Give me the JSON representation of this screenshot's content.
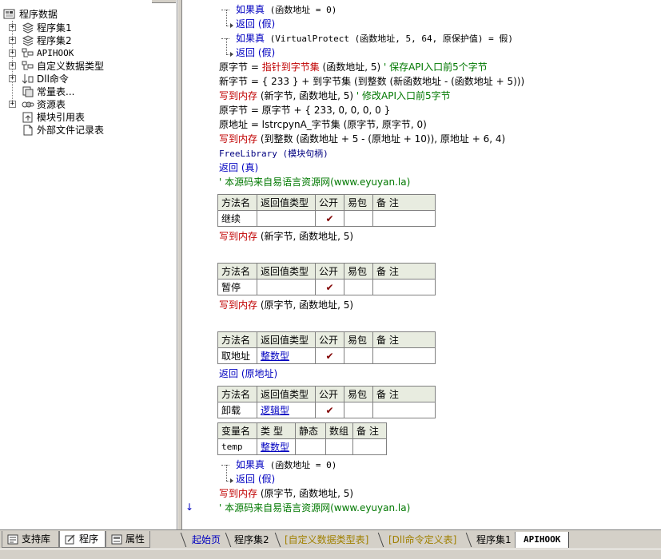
{
  "tree": {
    "root": "程序数据",
    "items": [
      {
        "label": "程序集1",
        "expandable": true
      },
      {
        "label": "程序集2",
        "expandable": true
      },
      {
        "label": "APIHOOK",
        "expandable": true
      },
      {
        "label": "自定义数据类型",
        "expandable": true
      },
      {
        "label": "Dll命令",
        "expandable": true
      },
      {
        "label": "常量表...",
        "expandable": false
      },
      {
        "label": "资源表",
        "expandable": true
      },
      {
        "label": "模块引用表",
        "expandable": false
      },
      {
        "label": "外部文件记录表",
        "expandable": false
      }
    ]
  },
  "code": {
    "lines": {
      "l1_kw": "如果真",
      "l1_rest": " (函数地址 = 0)",
      "l2": "返回 (假)",
      "l3_kw": "如果真",
      "l3_rest": " (VirtualProtect (函数地址, 5, 64, 原保护值) = 假)",
      "l4": "返回 (假)",
      "l5_a": "原字节 = ",
      "l5_b": "指针到字节集",
      "l5_c": " (函数地址, 5) ",
      "l5_cmt": "' 保存API入口前5个字节",
      "l6": "新字节 = { 233 } + 到字节集 (到整数 (新函数地址 - (函数地址 + 5)))",
      "l7_a": "写到内存",
      "l7_b": " (新字节, 函数地址, 5) ",
      "l7_cmt": "' 修改API入口前5字节",
      "l8": "原字节 = 原字节 + { 233, 0, 0, 0, 0 }",
      "l9": "原地址 = lstrcpynA_字节集 (原字节, 原字节, 0)",
      "l10_a": "写到内存",
      "l10_b": " (到整数 (函数地址 + 5 - (原地址 + 10)), 原地址 + 6, 4)",
      "l11": "FreeLibrary (模块句柄)",
      "l12": "返回 (真)",
      "l13": "' 本源码来自易语言资源网(www.eyuyan.la)",
      "l14_a": "写到内存",
      "l14_b": " (新字节, 函数地址, 5)",
      "l15_a": "写到内存",
      "l15_b": " (原字节, 函数地址, 5)",
      "l16": "返回 (原地址)",
      "l17_kw": "如果真",
      "l17_rest": " (函数地址 = 0)",
      "l18": "返回 (假)",
      "l19_a": "写到内存",
      "l19_b": " (原字节, 函数地址, 5)",
      "l20": "' 本源码来自易语言资源网(www.eyuyan.la)"
    },
    "method_header": {
      "name": "方法名",
      "ret": "返回值类型",
      "pub": "公开",
      "easy": "易包",
      "note": "备 注"
    },
    "var_header": {
      "name": "变量名",
      "type": "类 型",
      "static": "静态",
      "array": "数组",
      "note": "备 注"
    },
    "methods": [
      {
        "name": "继续",
        "ret": "",
        "pub": "✔"
      },
      {
        "name": "暂停",
        "ret": "",
        "pub": "✔"
      },
      {
        "name": "取地址",
        "ret": "整数型",
        "pub": "✔"
      },
      {
        "name": "卸载",
        "ret": "逻辑型",
        "pub": "✔"
      }
    ],
    "var": {
      "name": "temp",
      "type": "整数型"
    },
    "marker": "↓"
  },
  "left_tabs": [
    {
      "label": "支持库"
    },
    {
      "label": "程序"
    },
    {
      "label": "属性"
    }
  ],
  "code_tabs": [
    {
      "label": "起始页"
    },
    {
      "label": "程序集2"
    },
    {
      "label": "[自定义数据类型表]"
    },
    {
      "label": "[Dll命令定义表]"
    },
    {
      "label": "程序集1"
    },
    {
      "label": "APIHOOK"
    }
  ],
  "colors": {
    "keyword": "#0000c0",
    "command": "#c00000",
    "comment": "#007800",
    "table_header": "#e8ece0"
  }
}
